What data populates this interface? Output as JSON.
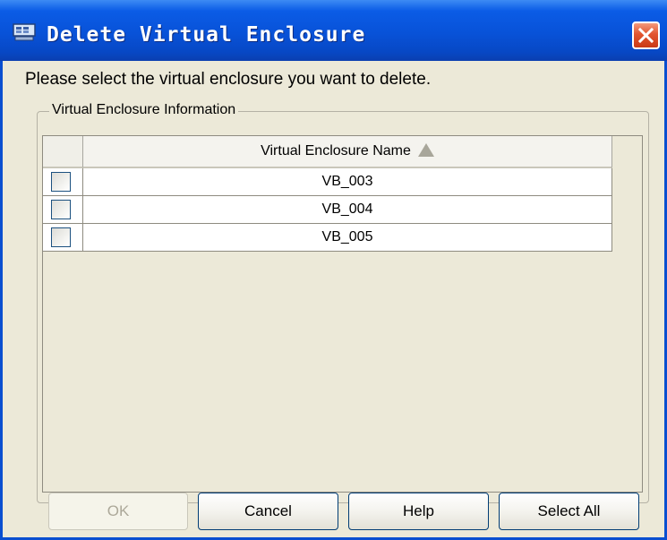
{
  "window": {
    "title": "Delete Virtual Enclosure",
    "title_icon": "enclosure-app-icon",
    "close_icon": "close-x-icon"
  },
  "prompt": "Please select the virtual enclosure you want to delete.",
  "group": {
    "label": "Virtual Enclosure Information"
  },
  "table": {
    "column_header": "Virtual Enclosure Name",
    "sort_icon": "sort-ascending-icon",
    "rows": [
      {
        "name": "VB_003",
        "checked": false
      },
      {
        "name": "VB_004",
        "checked": false
      },
      {
        "name": "VB_005",
        "checked": false
      }
    ]
  },
  "buttons": {
    "ok": {
      "label": "OK",
      "enabled": false
    },
    "cancel": {
      "label": "Cancel",
      "enabled": true
    },
    "help": {
      "label": "Help",
      "enabled": true
    },
    "select_all": {
      "label": "Select All",
      "enabled": true
    }
  },
  "colors": {
    "titlebar": "#0852d8",
    "dialog_bg": "#ece9d8",
    "close_button": "#e2552f",
    "checkbox_border": "#1c5180"
  }
}
